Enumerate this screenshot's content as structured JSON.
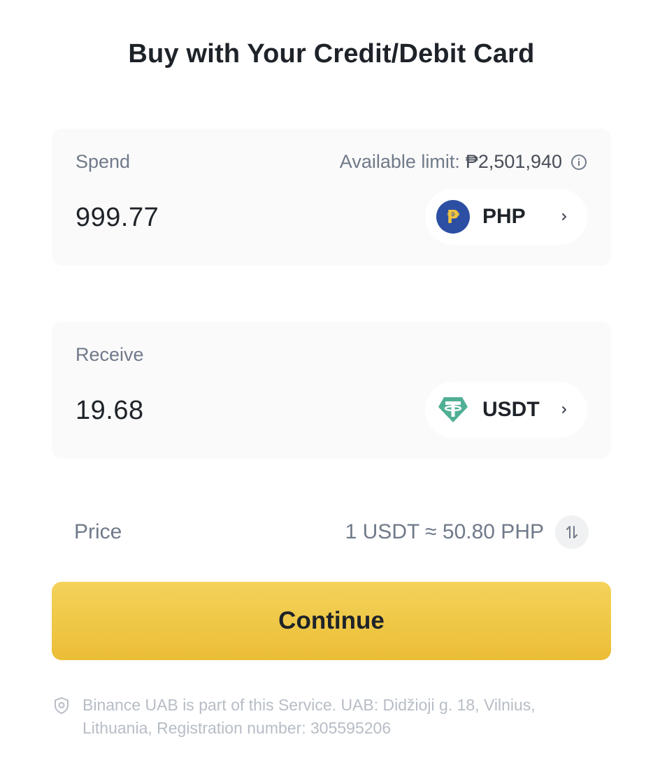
{
  "header": {
    "title": "Buy with Your Credit/Debit Card"
  },
  "spend": {
    "label": "Spend",
    "limit_label": "Available limit:",
    "limit_value": "₱2,501,940",
    "amount": "999.77",
    "currency": {
      "code": "PHP",
      "icon": "peso-coin-icon",
      "symbol": "₱",
      "color": "#2c4fa3"
    }
  },
  "receive": {
    "label": "Receive",
    "amount": "19.68",
    "currency": {
      "code": "USDT",
      "icon": "tether-coin-icon",
      "color": "#50af95"
    }
  },
  "price": {
    "label": "Price",
    "value": "1 USDT ≈ 50.80 PHP"
  },
  "actions": {
    "continue_label": "Continue",
    "accent_color": "#f0c43f"
  },
  "footer": {
    "text": "Binance UAB is part of this Service. UAB: Didžioji g. 18, Vilnius, Lithuania, Registration number: 305595206"
  }
}
